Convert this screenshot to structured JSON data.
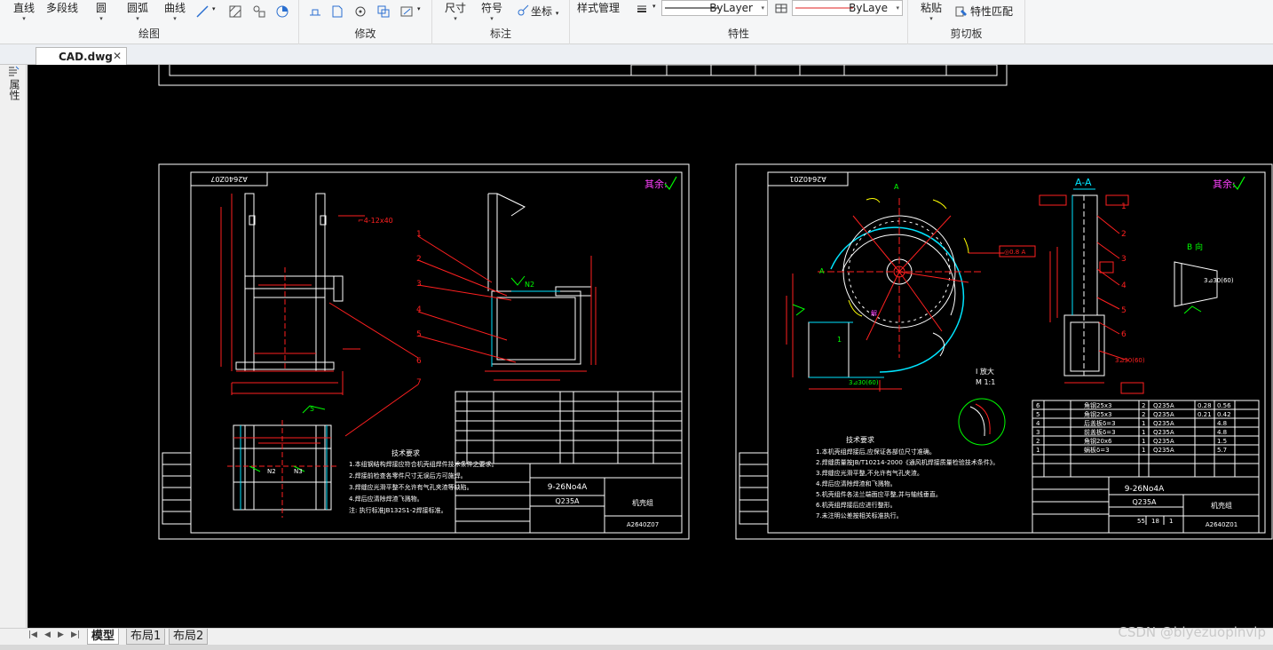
{
  "ribbon": {
    "draw": {
      "title": "绘图",
      "line": "直线",
      "polyline": "多段线",
      "circle": "圆",
      "arc": "圆弧",
      "curve": "曲线"
    },
    "modify": {
      "title": "修改"
    },
    "annotate": {
      "title": "标注",
      "dimension": "尺寸",
      "symbol": "符号",
      "coordinate": "坐标"
    },
    "properties": {
      "title": "特性",
      "style_manager": "样式管理",
      "linetype": "ByLayer",
      "color": "ByLaye"
    },
    "clipboard": {
      "title": "剪切板",
      "paste": "粘贴",
      "match_props": "特性匹配"
    }
  },
  "document_tab": {
    "name": "CAD.dwg",
    "close": "✕"
  },
  "left_panel": {
    "label": "属性"
  },
  "layout_tabs": [
    {
      "label": "模型",
      "active": true
    },
    {
      "label": "布局1",
      "active": false
    },
    {
      "label": "布局2",
      "active": false
    }
  ],
  "drawing": {
    "sheet_left": {
      "code_top": "A2640Z07",
      "title_block_name": "9-26No4A",
      "title_block_material": "Q235A",
      "title_block_part": "机壳组",
      "title_block_code": "A2640Z07",
      "note_heading": "技术要求",
      "notes": [
        "1.本组钢结构焊接应符合机壳组焊件技术条件之要求。",
        "2.焊接前检查各零件尺寸无误后方可施焊。",
        "3.焊缝应光滑平整不允许有气孔夹渣等缺陷。",
        "4.焊后应清除焊渣飞溅物。",
        "注: 执行标准JB132S1-2焊接标准。"
      ],
      "balloons": [
        "1",
        "2",
        "3",
        "4",
        "5",
        "6",
        "7"
      ]
    },
    "sheet_right": {
      "code_top": "A2640Z01",
      "section_label": "A-A",
      "view_b_label": "B 向",
      "title_block_name": "9-26No4A",
      "title_block_material": "Q235A",
      "title_block_part": "机壳组",
      "title_block_code": "A2640Z01",
      "title_block_nums": [
        "55",
        "18",
        "1"
      ],
      "note_heading": "技术要求",
      "notes": [
        "1.本机壳组焊接后,应保证各部位尺寸准确。",
        "2.焊缝质量按JB/T10214-2000《通风机焊接质量检验技术条件》。",
        "3.焊缝应光滑平整,不允许有气孔夹渣。",
        "4.焊后应清除焊渣和飞溅物。",
        "5.机壳组件各法兰端面应平整,并与轴线垂直。",
        "6.机壳组焊接后应进行整形。",
        "7.未注明公差按相关标准执行。"
      ],
      "bom": [
        {
          "no": "6",
          "name": "角钢25x3",
          "qty": "2",
          "mat": "Q235A",
          "w1": "0.28",
          "w2": "0.56"
        },
        {
          "no": "5",
          "name": "角钢25x3",
          "qty": "2",
          "mat": "Q235A",
          "w1": "0.21",
          "w2": "0.42"
        },
        {
          "no": "4",
          "name": "后盖板δ=3",
          "qty": "1",
          "mat": "Q235A",
          "w1": "",
          "w2": "4.8"
        },
        {
          "no": "3",
          "name": "前盖板δ=3",
          "qty": "1",
          "mat": "Q235A",
          "w1": "",
          "w2": "4.8"
        },
        {
          "no": "2",
          "name": "角钢20x6",
          "qty": "1",
          "mat": "Q235A",
          "w1": "",
          "w2": "1.5"
        },
        {
          "no": "1",
          "name": "蜗板δ=3",
          "qty": "1",
          "mat": "Q235A",
          "w1": "",
          "w2": "5.7"
        }
      ],
      "balloons": [
        "1",
        "2",
        "3",
        "4",
        "5",
        "6"
      ]
    },
    "checkmark_text": "其余:"
  },
  "watermark": "CSDN @biyezuopinvip",
  "colors": {
    "canvas": "#000000",
    "line_white": "#ffffff",
    "line_red": "#ff2020",
    "line_cyan": "#00e5ff",
    "line_green": "#00ff00",
    "line_yellow": "#ffff00",
    "line_magenta": "#ff40ff"
  }
}
